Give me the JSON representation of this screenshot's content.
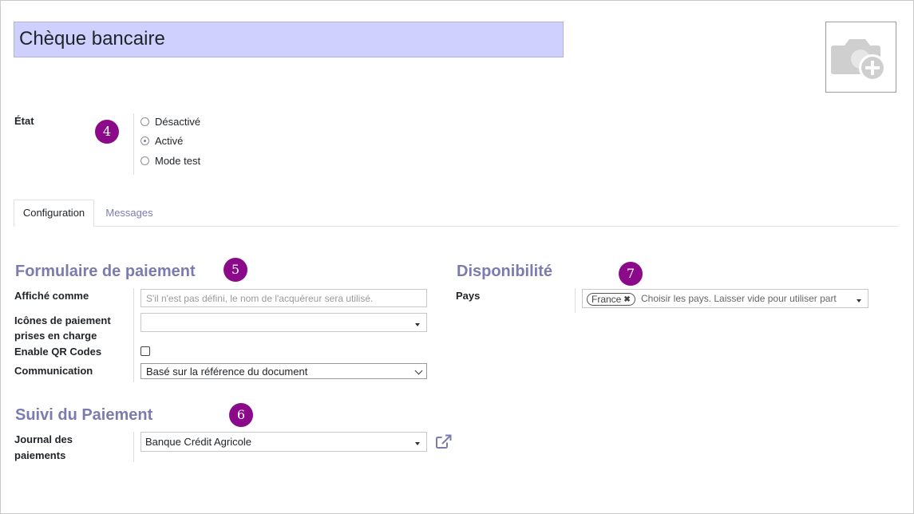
{
  "record": {
    "name": "Chèque bancaire"
  },
  "state": {
    "label": "État",
    "options": [
      {
        "label": "Désactivé",
        "selected": false
      },
      {
        "label": "Activé",
        "selected": true
      },
      {
        "label": "Mode test",
        "selected": false
      }
    ]
  },
  "tabs": [
    {
      "label": "Configuration",
      "active": true
    },
    {
      "label": "Messages",
      "active": false
    }
  ],
  "payment_form": {
    "title": "Formulaire de paiement",
    "display_as_label": "Affiché comme",
    "display_as_placeholder": "S'il n'est pas défini, le nom de l'acquéreur sera utilisé.",
    "icons_label_line1": "Icônes de paiement",
    "icons_label_line2": "prises en charge",
    "icons_value": "",
    "qr_label": "Enable QR Codes",
    "qr_checked": false,
    "communication_label": "Communication",
    "communication_value": "Basé sur la référence du document"
  },
  "availability": {
    "title": "Disponibilité",
    "countries_label": "Pays",
    "country_tag": "France",
    "countries_placeholder": "Choisir les pays. Laisser vide pour utiliser part"
  },
  "payment_followup": {
    "title": "Suivi du Paiement",
    "journal_label_line1": "Journal des",
    "journal_label_line2": "paiements",
    "journal_value": "Banque Crédit Agricole"
  },
  "badges": {
    "b4": "4",
    "b5": "5",
    "b6": "6",
    "b7": "7"
  },
  "colors": {
    "accent": "#7c7bad",
    "title_bg": "#d0d0ff",
    "badge": "#8a0a8a"
  },
  "icons": [
    "camera-add-icon",
    "external-link-icon",
    "remove-tag-icon",
    "dropdown-caret-icon",
    "chevron-down-icon"
  ]
}
